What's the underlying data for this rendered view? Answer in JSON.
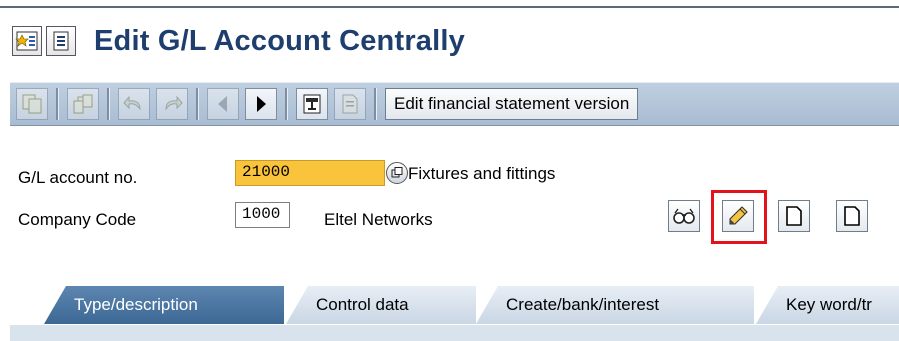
{
  "title": "Edit G/L Account Centrally",
  "toolbar": {
    "edit_fs_version_label": "Edit financial statement version"
  },
  "form": {
    "gl_account": {
      "label": "G/L account no.",
      "value": "21000",
      "description": "Fixtures and fittings"
    },
    "company_code": {
      "label": "Company Code",
      "value": "1000",
      "description": "Eltel Networks"
    }
  },
  "tabs": [
    {
      "label": "Type/description",
      "active": true
    },
    {
      "label": "Control data",
      "active": false
    },
    {
      "label": "Create/bank/interest",
      "active": false
    },
    {
      "label": "Key word/tr",
      "active": false
    }
  ],
  "colors": {
    "title": "#1e3f6e",
    "required_field": "#f9c33b",
    "highlight": "#e2131b",
    "active_tab": "#3c6895"
  },
  "icons": {
    "title": [
      "menu-favorites-icon",
      "menu-list-icon"
    ],
    "toolbar": [
      "copy-icon",
      "copy-structure-icon",
      "undo-icon",
      "redo-icon",
      "previous-icon",
      "next-icon",
      "print-icon",
      "document-icon"
    ],
    "mode": [
      "display-icon",
      "edit-pencil-icon",
      "create-icon",
      "create-with-reference-icon"
    ]
  }
}
